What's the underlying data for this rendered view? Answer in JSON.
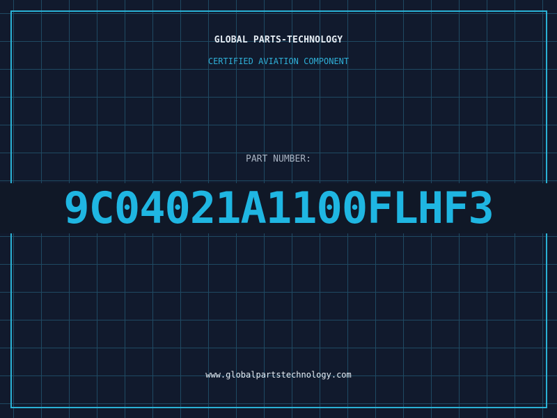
{
  "header": {
    "company": "GLOBAL PARTS-TECHNOLOGY",
    "subtitle": "CERTIFIED AVIATION COMPONENT"
  },
  "part": {
    "label": "PART NUMBER:",
    "number": "9C04021A1100FLHF3"
  },
  "footer": {
    "website": "www.globalpartstechnology.com"
  },
  "colors": {
    "background": "#111a2d",
    "grid": "#1f4a63",
    "frame": "#2ab2d6",
    "accent": "#1fb6e2"
  }
}
